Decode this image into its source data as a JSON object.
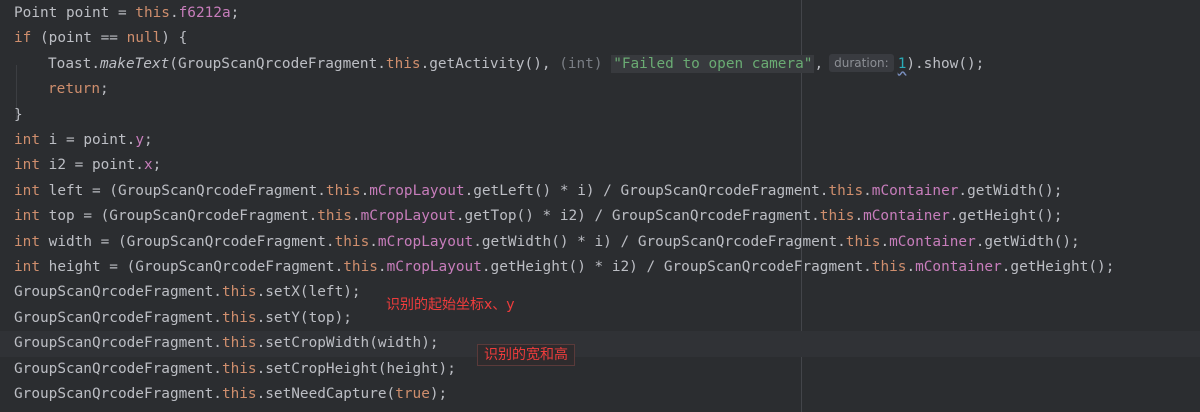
{
  "code": {
    "l1": {
      "a": "Point point = ",
      "kw_this": "this",
      "dot": ".",
      "field": "f6212a",
      "end": ";"
    },
    "l2": {
      "kw_if": "if",
      "rest": " (point == ",
      "kw_null": "null",
      "end": ") {"
    },
    "l3": {
      "a": "Toast.",
      "method": "makeText",
      "b": "(GroupScanQrcodeFragment.",
      "kw_this": "this",
      "c": ".getActivity(), ",
      "cast": "(int)",
      "d": " ",
      "string": "\"Failed to open camera\"",
      "comma": ",",
      "hint": "duration:",
      "number": "1",
      "end": ").show();"
    },
    "l4": {
      "kw_return": "return",
      "end": ";"
    },
    "l5": {
      "text": "}"
    },
    "l6": {
      "kw_int": "int",
      "a": " i = point.",
      "field": "y",
      "end": ";"
    },
    "l7": {
      "kw_int": "int",
      "a": " i2 = point.",
      "field": "x",
      "end": ";"
    },
    "l8": {
      "kw_int": "int",
      "a": " left = (GroupScanQrcodeFragment.",
      "kw_this": "this",
      "dot": ".",
      "field": "mCropLayout",
      "b": ".getLeft() * i) / GroupScanQrcodeFragment.",
      "kw_this2": "this",
      "dot2": ".",
      "field2": "mContainer",
      "end": ".getWidth();"
    },
    "l9": {
      "kw_int": "int",
      "a": " top = (GroupScanQrcodeFragment.",
      "kw_this": "this",
      "dot": ".",
      "field": "mCropLayout",
      "b": ".getTop() * i2) / GroupScanQrcodeFragment.",
      "kw_this2": "this",
      "dot2": ".",
      "field2": "mContainer",
      "end": ".getHeight();"
    },
    "l10": {
      "kw_int": "int",
      "a": " width = (GroupScanQrcodeFragment.",
      "kw_this": "this",
      "dot": ".",
      "field": "mCropLayout",
      "b": ".getWidth() * i) / GroupScanQrcodeFragment.",
      "kw_this2": "this",
      "dot2": ".",
      "field2": "mContainer",
      "end": ".getWidth();"
    },
    "l11": {
      "kw_int": "int",
      "a": " height = (GroupScanQrcodeFragment.",
      "kw_this": "this",
      "dot": ".",
      "field": "mCropLayout",
      "b": ".getHeight() * i2) / GroupScanQrcodeFragment.",
      "kw_this2": "this",
      "dot2": ".",
      "field2": "mContainer",
      "end": ".getHeight();"
    },
    "l12": {
      "a": "GroupScanQrcodeFragment.",
      "kw_this": "this",
      "end": ".setX(left);"
    },
    "l13": {
      "a": "GroupScanQrcodeFragment.",
      "kw_this": "this",
      "end": ".setY(top);"
    },
    "l14": {
      "a": "GroupScanQrcodeFragment.",
      "kw_this": "this",
      "end": ".setCropWidth(width);"
    },
    "l15": {
      "a": "GroupScanQrcodeFragment.",
      "kw_this": "this",
      "end": ".setCropHeight(height);"
    },
    "l16": {
      "a": "GroupScanQrcodeFragment.",
      "kw_this": "this",
      "b": ".setNeedCapture(",
      "kw_true": "true",
      "end": ");"
    }
  },
  "annotations": {
    "xy": "识别的起始坐标x、y",
    "wh": "识别的宽和高"
  },
  "colors": {
    "background": "#2b2d30",
    "keyword": "#cf8e6d",
    "field": "#c77dbb",
    "string": "#6aab73",
    "number": "#2aacb8",
    "annotation": "#ee3c3c"
  }
}
